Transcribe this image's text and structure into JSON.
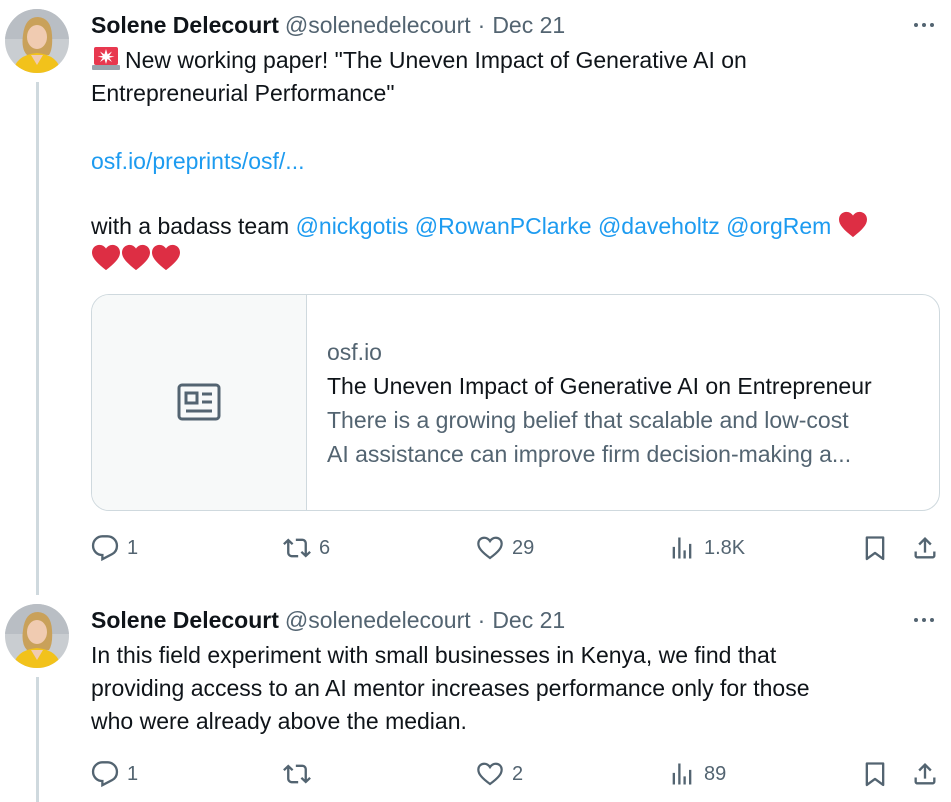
{
  "tweets": [
    {
      "author": {
        "name": "Solene Delecourt",
        "handle": "@solenedelecourt",
        "separator": "·",
        "date": "Dec 21"
      },
      "text": {
        "line1_prefix_icon": "siren-emoji",
        "line1": "New working paper! \"The Uneven Impact of Generative AI on",
        "line2": "Entrepreneurial Performance\"",
        "link": "osf.io/preprints/osf/...",
        "team_prefix": "with a badass team ",
        "mentions": [
          "@nickgotis",
          "@RowanPClarke",
          "@daveholtz",
          "@orgRem"
        ],
        "hearts": 4
      },
      "card": {
        "icon": "article-icon",
        "domain": "osf.io",
        "title": "The Uneven Impact of Generative AI on Entrepreneur",
        "desc_line1": "There is a growing belief that scalable and low-cost",
        "desc_line2": "AI assistance can improve firm decision-making a..."
      },
      "actions": {
        "replies": "1",
        "reposts": "6",
        "likes": "29",
        "views": "1.8K"
      }
    },
    {
      "author": {
        "name": "Solene Delecourt",
        "handle": "@solenedelecourt",
        "separator": "·",
        "date": "Dec 21"
      },
      "text": {
        "line1": "In this field experiment with small businesses in Kenya, we find that",
        "line2": "providing access to an AI mentor increases performance only for those",
        "line3": "who were already above the median."
      },
      "actions": {
        "replies": "1",
        "reposts": "",
        "likes": "2",
        "views": "89"
      }
    }
  ],
  "colors": {
    "link": "#1d9bf0",
    "muted": "#536471",
    "text": "#0f1419",
    "heart": "#e0245e",
    "border": "#cfd9de"
  }
}
